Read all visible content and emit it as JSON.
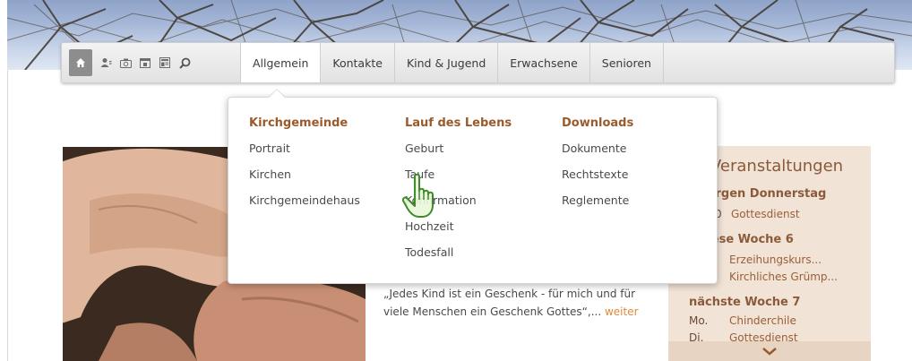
{
  "nav": {
    "icons": [
      "home-icon",
      "contacts-icon",
      "camera-icon",
      "calendar-icon",
      "newsletter-icon",
      "search-icon"
    ],
    "tabs": [
      {
        "label": "Allgemein",
        "active": true
      },
      {
        "label": "Kontakte",
        "active": false
      },
      {
        "label": "Kind & Jugend",
        "active": false
      },
      {
        "label": "Erwachsene",
        "active": false
      },
      {
        "label": "Senioren",
        "active": false
      }
    ]
  },
  "dropdown": {
    "columns": [
      {
        "heading": "Kirchgemeinde",
        "items": [
          "Portrait",
          "Kirchen",
          "Kirchgemeindehaus"
        ]
      },
      {
        "heading": "Lauf des Lebens",
        "items": [
          "Geburt",
          "Taufe",
          "Konfirmation",
          "Hochzeit",
          "Todesfall"
        ]
      },
      {
        "heading": "Downloads",
        "items": [
          "Dokumente",
          "Rechtstexte",
          "Reglemente"
        ]
      }
    ]
  },
  "quote": {
    "text": "„Jedes Kind ist ein Geschenk - für mich und für viele Menschen ein Geschenk Gottes“,...",
    "more": "weiter"
  },
  "events": {
    "title": "Veranstaltungen",
    "sections": [
      {
        "day": "morgen Donnerstag",
        "rows": [
          {
            "d": "20:00",
            "t": "Gottesdienst"
          }
        ]
      },
      {
        "day": "diese Woche 6",
        "rows": [
          {
            "d": "",
            "t": "Erzeihungskurs..."
          },
          {
            "d": "",
            "t": "Kirchliches Grümp..."
          }
        ]
      },
      {
        "day": "nächste Woche 7",
        "rows": [
          {
            "d": "Mo.",
            "t": "Chinderchile"
          },
          {
            "d": "Di.",
            "t": "Gottesdienst"
          }
        ]
      }
    ]
  },
  "colors": {
    "accent": "#9a5a2c",
    "link_more": "#e08a3c",
    "events_bg": "#f1e3d6"
  }
}
